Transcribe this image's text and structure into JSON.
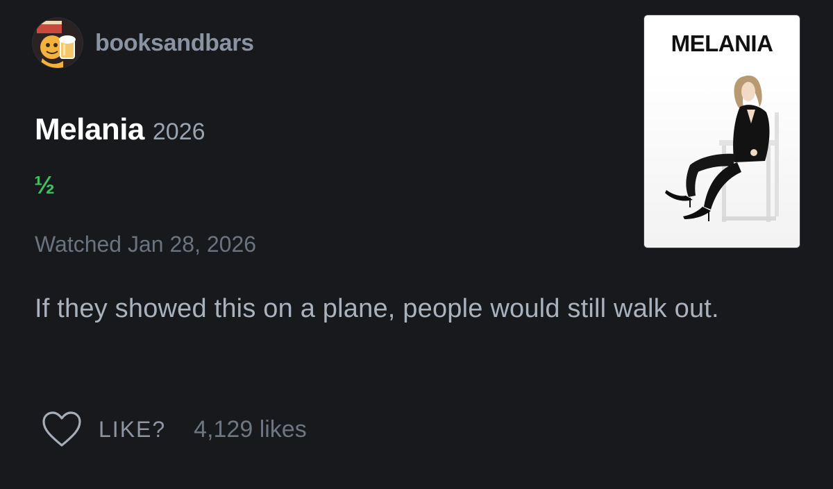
{
  "review": {
    "username": "booksandbars",
    "film_title": "Melania",
    "film_year": "2026",
    "rating": "½",
    "watched": "Watched Jan 28, 2026",
    "text": "If they showed this on a plane, people would still walk out.",
    "like_label": "LIKE?",
    "likes_count": "4,129 likes"
  },
  "poster": {
    "title": "MELANIA"
  },
  "icons": {
    "heart": "heart-icon",
    "avatar": "avatar-icon"
  },
  "colors": {
    "background": "#17191d",
    "rating_green": "#3fbf5f",
    "title": "#ffffff",
    "muted": "#6b737f"
  }
}
